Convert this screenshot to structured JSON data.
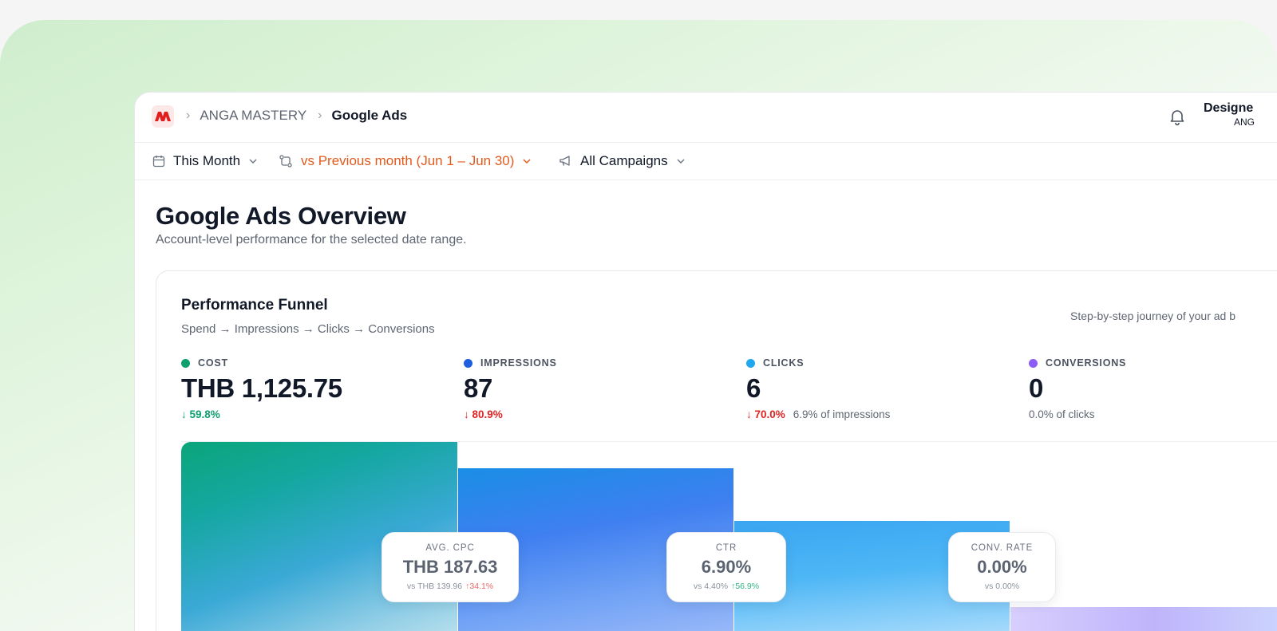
{
  "breadcrumb": {
    "org": "ANGA MASTERY",
    "page": "Google Ads"
  },
  "user": {
    "name": "Designe",
    "org": "ANG"
  },
  "filters": {
    "period": "This Month",
    "comparison": "vs Previous month (Jun 1 – Jun 30)",
    "campaigns": "All Campaigns"
  },
  "page": {
    "title": "Google Ads Overview",
    "subtitle": "Account-level performance for the selected date range."
  },
  "funnel": {
    "title": "Performance Funnel",
    "subtitle": "Spend → Impressions → Clicks → Conversions",
    "note": "Step-by-step journey of your ad b",
    "metrics": [
      {
        "label": "COST",
        "value": "THB 1,125.75",
        "delta": "↓ 59.8%",
        "note": "",
        "color": "#0e9f6e"
      },
      {
        "label": "IMPRESSIONS",
        "value": "87",
        "delta": "↓ 80.9%",
        "note": "",
        "color": "#1d5fe0"
      },
      {
        "label": "CLICKS",
        "value": "6",
        "delta": "↓ 70.0%",
        "note": "6.9% of impressions",
        "color": "#1ea7ec"
      },
      {
        "label": "CONVERSIONS",
        "value": "0",
        "delta": "",
        "note": "0.0% of clicks",
        "color": "#8b5cf6"
      }
    ],
    "kpis": [
      {
        "label": "AVG. CPC",
        "value": "THB 187.63",
        "compare": "vs THB 139.96",
        "change": "↑34.1%"
      },
      {
        "label": "CTR",
        "value": "6.90%",
        "compare": "vs 4.40%",
        "change": "↑56.9%"
      },
      {
        "label": "CONV. RATE",
        "value": "0.00%",
        "compare": "vs 0.00%",
        "change": ""
      }
    ]
  }
}
